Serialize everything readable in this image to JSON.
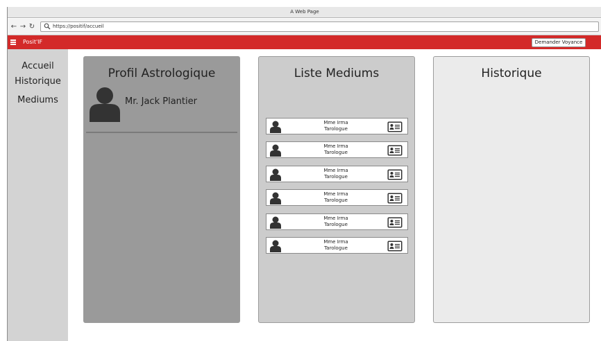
{
  "window": {
    "title": "A Web Page"
  },
  "browser": {
    "back_icon": "arrow-left-icon",
    "forward_icon": "arrow-right-icon",
    "reload_icon": "reload-icon",
    "url": "https://positif/accueil"
  },
  "appbar": {
    "brand": "Posit'IF",
    "action_label": "Demander Voyance",
    "background_color": "#d32a29"
  },
  "sidebar": {
    "items": [
      {
        "label": "Accueil"
      },
      {
        "label": "Historique"
      },
      {
        "label": "Mediums"
      }
    ]
  },
  "profile": {
    "title": "Profil Astrologique",
    "name": "Mr. Jack Plantier"
  },
  "mediums": {
    "title": "Liste Mediums",
    "items": [
      {
        "name": "Mme Irma",
        "role": "Tarologue"
      },
      {
        "name": "Mme Irma",
        "role": "Tarologue"
      },
      {
        "name": "Mme Irma",
        "role": "Tarologue"
      },
      {
        "name": "Mme Irma",
        "role": "Tarologue"
      },
      {
        "name": "Mme Irma",
        "role": "Tarologue"
      },
      {
        "name": "Mme Irma",
        "role": "Tarologue"
      }
    ]
  },
  "history": {
    "title": "Historique"
  }
}
